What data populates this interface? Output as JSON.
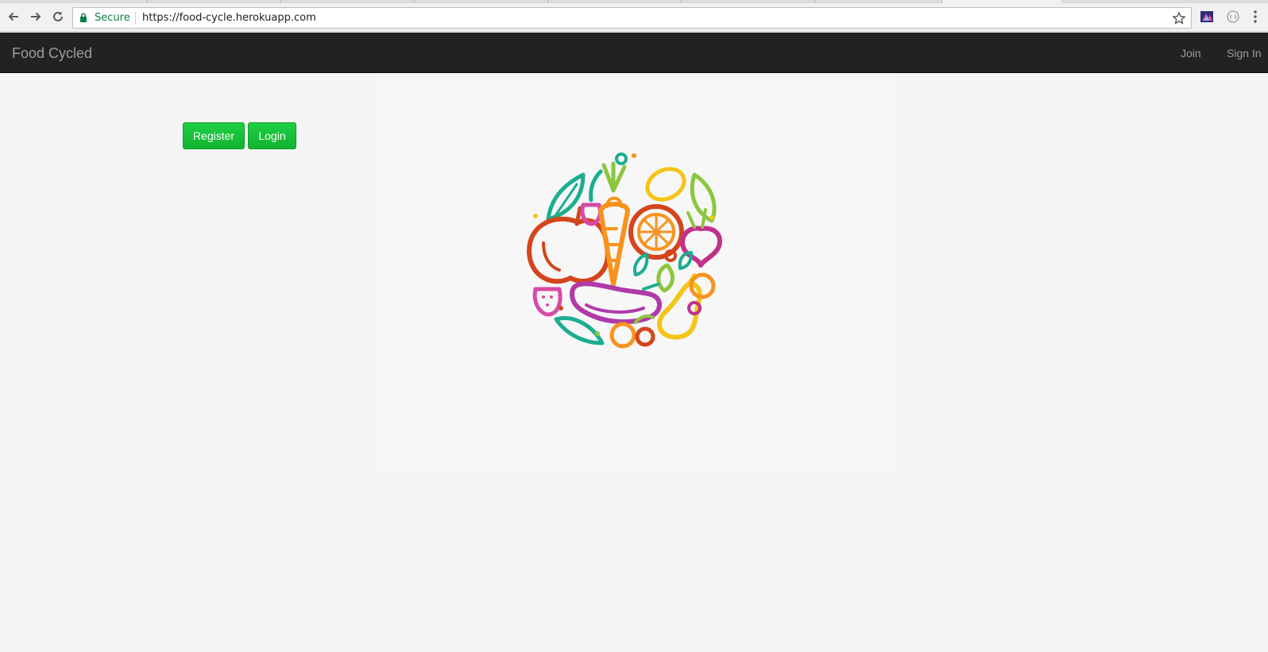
{
  "browser": {
    "secure_label": "Secure",
    "url": "https://food-cycle.herokuapp.com"
  },
  "navbar": {
    "brand": "Food Cycled",
    "links": [
      {
        "label": "Join"
      },
      {
        "label": "Sign In"
      }
    ]
  },
  "main": {
    "register_label": "Register",
    "login_label": "Login"
  },
  "colors": {
    "navbar_bg": "#222222",
    "button_green": "#16c13a",
    "secure_green": "#0b8043"
  },
  "icons": [
    "back-arrow-icon",
    "forward-arrow-icon",
    "reload-icon",
    "lock-icon",
    "star-icon",
    "extension-icon",
    "chrome-menu-icon",
    "produce-logo"
  ]
}
